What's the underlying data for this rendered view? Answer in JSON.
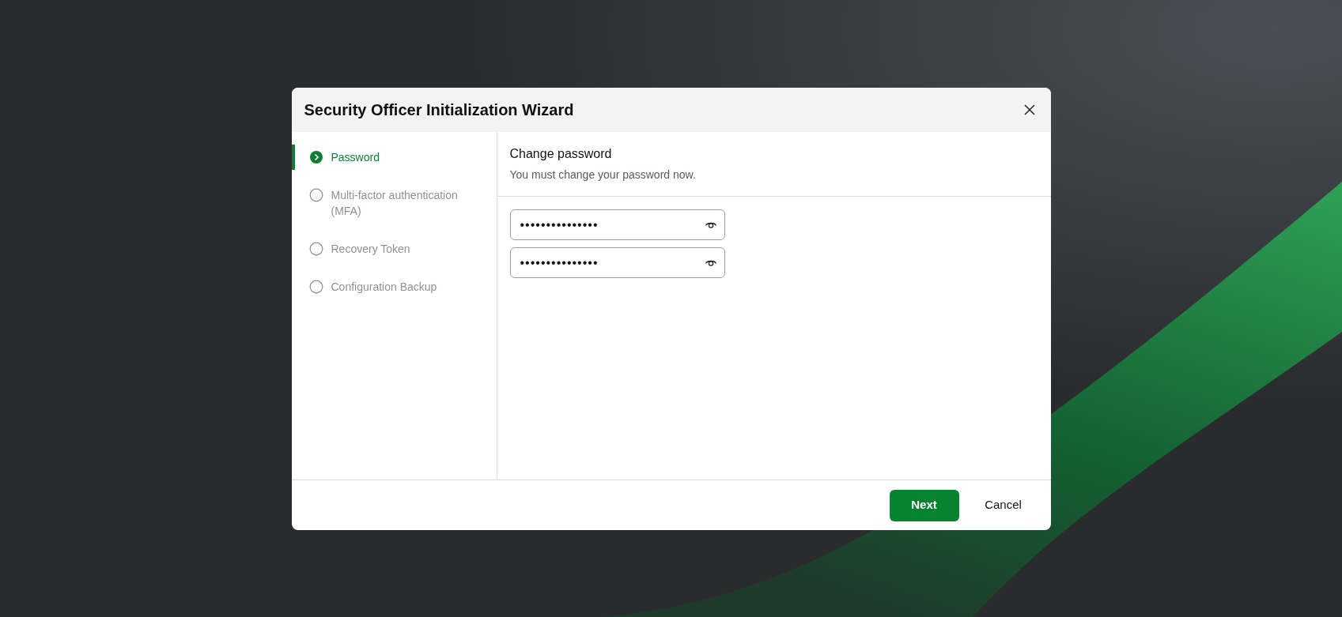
{
  "dialog": {
    "title": "Security Officer Initialization Wizard",
    "steps": [
      {
        "label": "Password",
        "selected": true
      },
      {
        "label": "Multi-factor authentication (MFA)",
        "selected": false
      },
      {
        "label": "Recovery Token",
        "selected": false
      },
      {
        "label": "Configuration Backup",
        "selected": false
      }
    ],
    "section": {
      "title": "Change password",
      "subtitle": "You must change your password now."
    },
    "fields": [
      {
        "value": "•••••••••••••••"
      },
      {
        "value": "•••••••••••••••"
      }
    ],
    "buttons": [
      {
        "label": "Next",
        "kind": "primary"
      },
      {
        "label": "Cancel",
        "kind": "plain"
      }
    ]
  }
}
